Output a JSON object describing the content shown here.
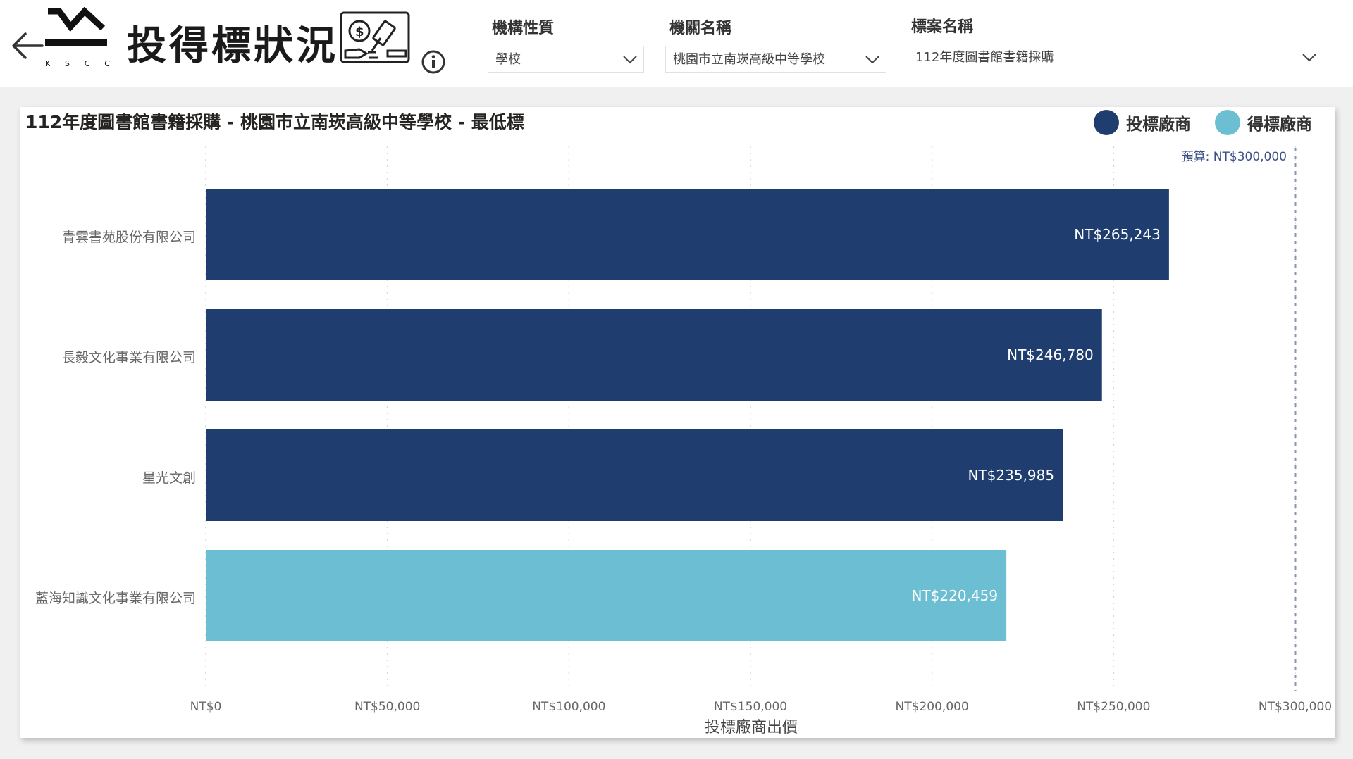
{
  "header": {
    "title": "投得標狀況",
    "logo_letters": [
      "K",
      "S",
      "C",
      "C"
    ]
  },
  "filters": [
    {
      "label": "機構性質",
      "value": "學校"
    },
    {
      "label": "機關名稱",
      "value": "桃園市立南崁高級中等學校"
    },
    {
      "label": "標案名稱",
      "value": "112年度圖書館書籍採購"
    }
  ],
  "chart_data": {
    "type": "bar",
    "orientation": "horizontal",
    "title": "112年度圖書館書籍採購 - 桃園市立南崁高級中等學校 - 最低標",
    "xlabel": "投標廠商出價",
    "ylabel": "",
    "xlim": [
      0,
      300000
    ],
    "x_ticks": [
      "NT$0",
      "NT$50,000",
      "NT$100,000",
      "NT$150,000",
      "NT$200,000",
      "NT$250,000",
      "NT$300,000"
    ],
    "x_tick_values": [
      0,
      50000,
      100000,
      150000,
      200000,
      250000,
      300000
    ],
    "grid": true,
    "legend_position": "top-right",
    "legend": [
      {
        "label": "投標廠商",
        "color": "#1f3d6e"
      },
      {
        "label": "得標廠商",
        "color": "#6cbfd2"
      }
    ],
    "categories": [
      "青雲書苑股份有限公司",
      "長毅文化事業有限公司",
      "星光文創",
      "藍海知識文化事業有限公司"
    ],
    "values": [
      265243,
      246780,
      235985,
      220459
    ],
    "value_labels": [
      "NT$265,243",
      "NT$246,780",
      "NT$235,985",
      "NT$220,459"
    ],
    "bar_series": [
      "投標廠商",
      "投標廠商",
      "投標廠商",
      "得標廠商"
    ],
    "reference_line": {
      "value": 300000,
      "label": "預算: NT$300,000",
      "color": "#8a93b8"
    }
  }
}
